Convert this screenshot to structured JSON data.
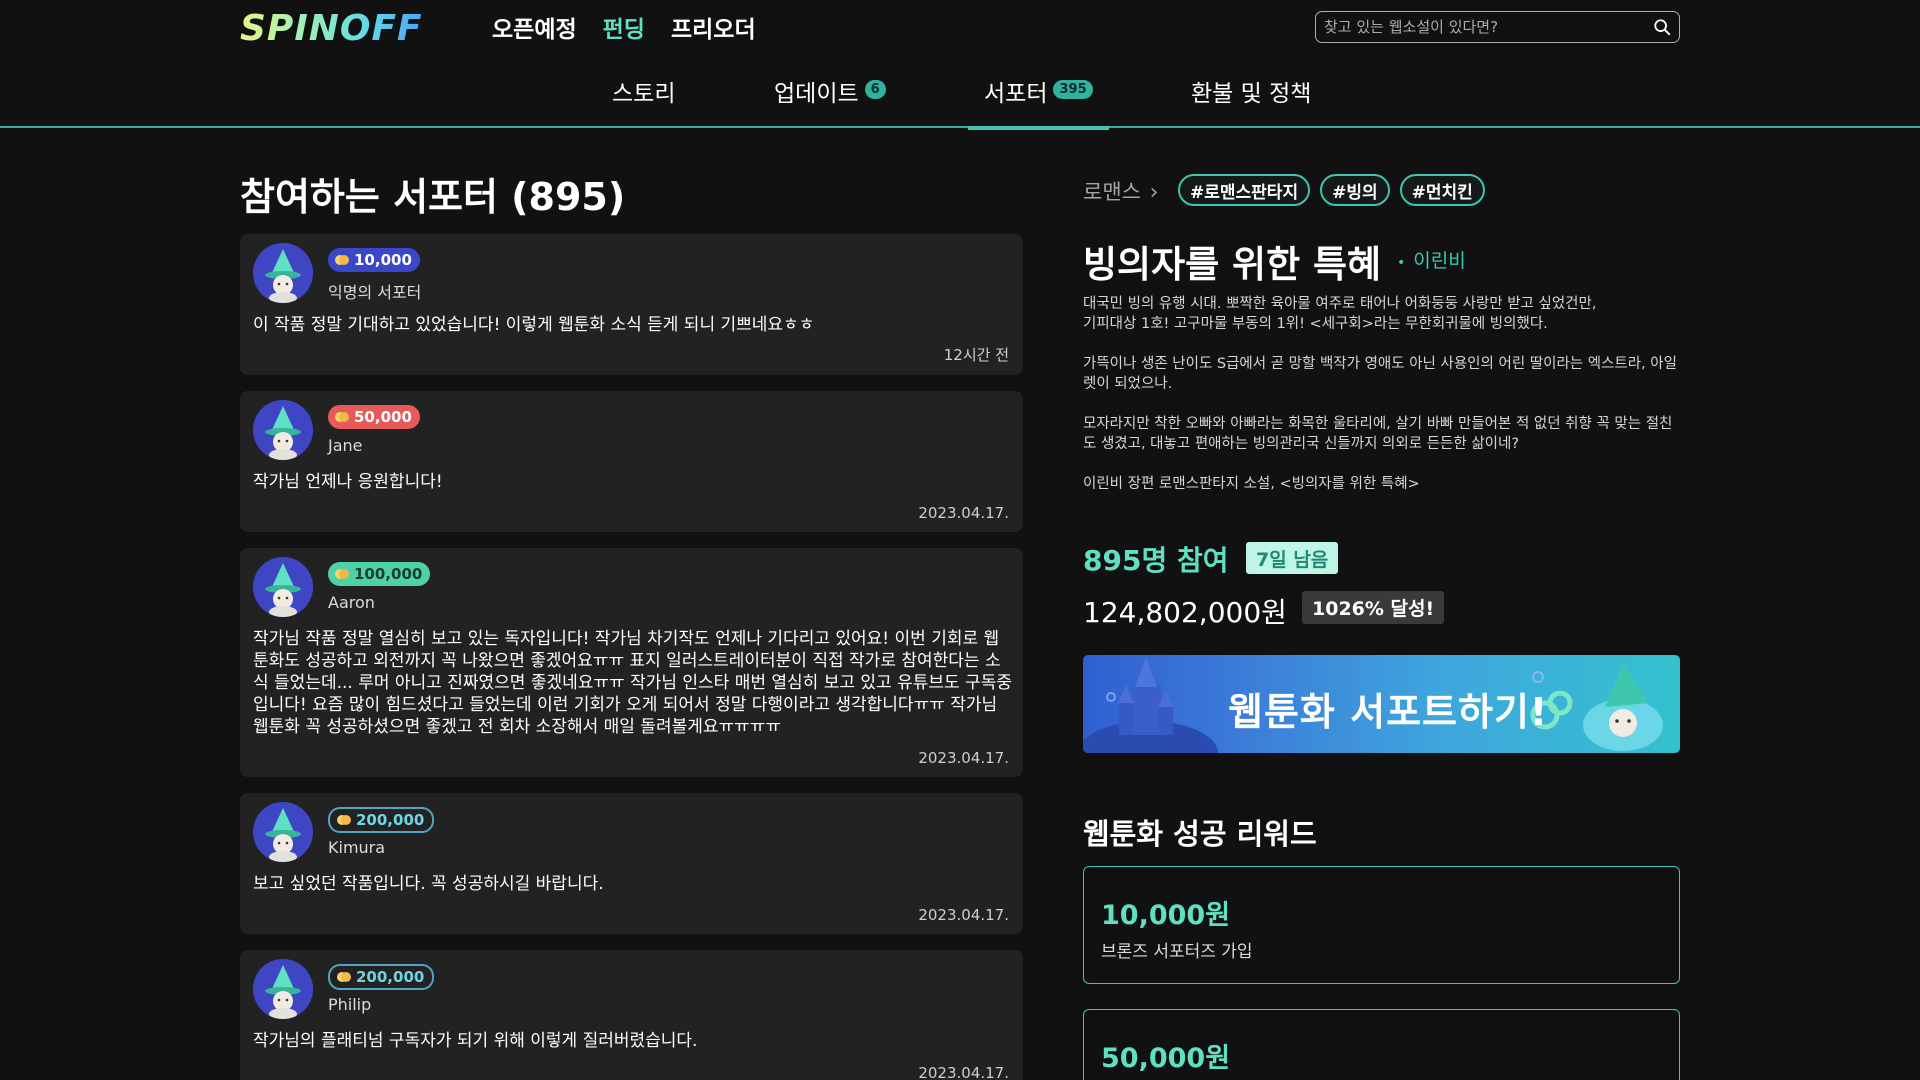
{
  "header": {
    "logo": "SPINOFF",
    "nav": [
      "오픈예정",
      "펀딩",
      "프리오더"
    ],
    "nav_active": 1,
    "search_placeholder": "찾고 있는 웹소설이 있다면?"
  },
  "tabs": [
    {
      "label": "스토리",
      "badge": ""
    },
    {
      "label": "업데이트",
      "badge": "6"
    },
    {
      "label": "서포터",
      "badge": "395"
    },
    {
      "label": "환불 및 정책",
      "badge": ""
    }
  ],
  "left": {
    "title": "참여하는 서포터 (895)",
    "supporters": [
      {
        "amount": "10,000",
        "name": "익명의 서포터",
        "message": "이 작품 정말 기대하고 있었습니다! 이렇게 웹툰화 소식 듣게 되니 기쁘네요ㅎㅎ",
        "time": "12시간 전",
        "tier": "blue"
      },
      {
        "amount": "50,000",
        "name": "Jane",
        "message": "작가님 언제나 응원합니다!",
        "time": "2023.04.17.",
        "tier": "red"
      },
      {
        "amount": "100,000",
        "name": "Aaron",
        "message": "작가님 작품 정말 열심히 보고 있는 독자입니다! 작가님 차기작도 언제나 기다리고 있어요! 이번 기회로 웹툰화도 성공하고 외전까지 꼭 나왔으면 좋겠어요ㅠㅠ 표지 일러스트레이터분이 직접 작가로 참여한다는 소식 들었는데... 루머 아니고 진짜였으면 좋겠네요ㅠㅠ 작가님 인스타 매번 열심히 보고 있고 유튜브도 구독중입니다! 요즘 많이 힘드셨다고 들었는데 이런 기회가 오게 되어서 정말 다행이라고 생각합니다ㅠㅠ 작가님 웹툰화 꼭 성공하셨으면 좋겠고 전 회차 소장해서 매일 돌려볼게요ㅠㅠㅠㅠ",
        "time": "2023.04.17.",
        "tier": "teal"
      },
      {
        "amount": "200,000",
        "name": "Kimura",
        "message": "보고 싶었던 작품입니다. 꼭 성공하시길 바랍니다.",
        "time": "2023.04.17.",
        "tier": "outline"
      },
      {
        "amount": "200,000",
        "name": "Philip",
        "message": "작가님의 플래티넘 구독자가 되기 위해 이렇게 질러버렸습니다.",
        "time": "2023.04.17.",
        "tier": "outline"
      }
    ]
  },
  "right": {
    "genre": "로맨스",
    "hashtags": [
      "#로맨스판타지",
      "#빙의",
      "#먼치킨"
    ],
    "title": "빙의자를 위한 특혜",
    "author": "이린비",
    "description": [
      "대국민 빙의 유행 시대. 뽀짝한 육아물 여주로 태어나 어화둥둥 사랑만 받고 싶었건만,\n기피대상 1호! 고구마물 부동의 1위! <세구회>라는 무한회귀물에 빙의했다.",
      "가뜩이나 생존 난이도 S급에서 곧 망할 백작가 영애도 아닌 사용인의 어린 딸이라는 엑스트라, 아일렛이 되었으나.",
      "모자라지만 착한 오빠와 아빠라는 화목한 울타리에, 살기 바빠 만들어본 적 없던 취향 꼭 맞는 절친도 생겼고, 대놓고 편애하는 빙의관리국 신들까지 의외로 든든한 삶이네?",
      "이린비 장편 로맨스판타지 소설, <빙의자를 위한 특혜>"
    ],
    "participants": "895명 참여",
    "remaining": "7일 남음",
    "raised": "124,802,000원",
    "achieved": "1026% 달성!",
    "cta": "웹툰화 서포트하기!",
    "reward_title": "웹툰화 성공 리워드",
    "rewards": [
      {
        "price": "10,000원",
        "desc": "브론즈 서포터즈 가입"
      },
      {
        "price": "50,000원",
        "desc": ""
      }
    ]
  },
  "colors": {
    "accent": "#3ec6ae",
    "accent_light": "#5fe0c0",
    "background": "#111111",
    "card": "#222222"
  }
}
